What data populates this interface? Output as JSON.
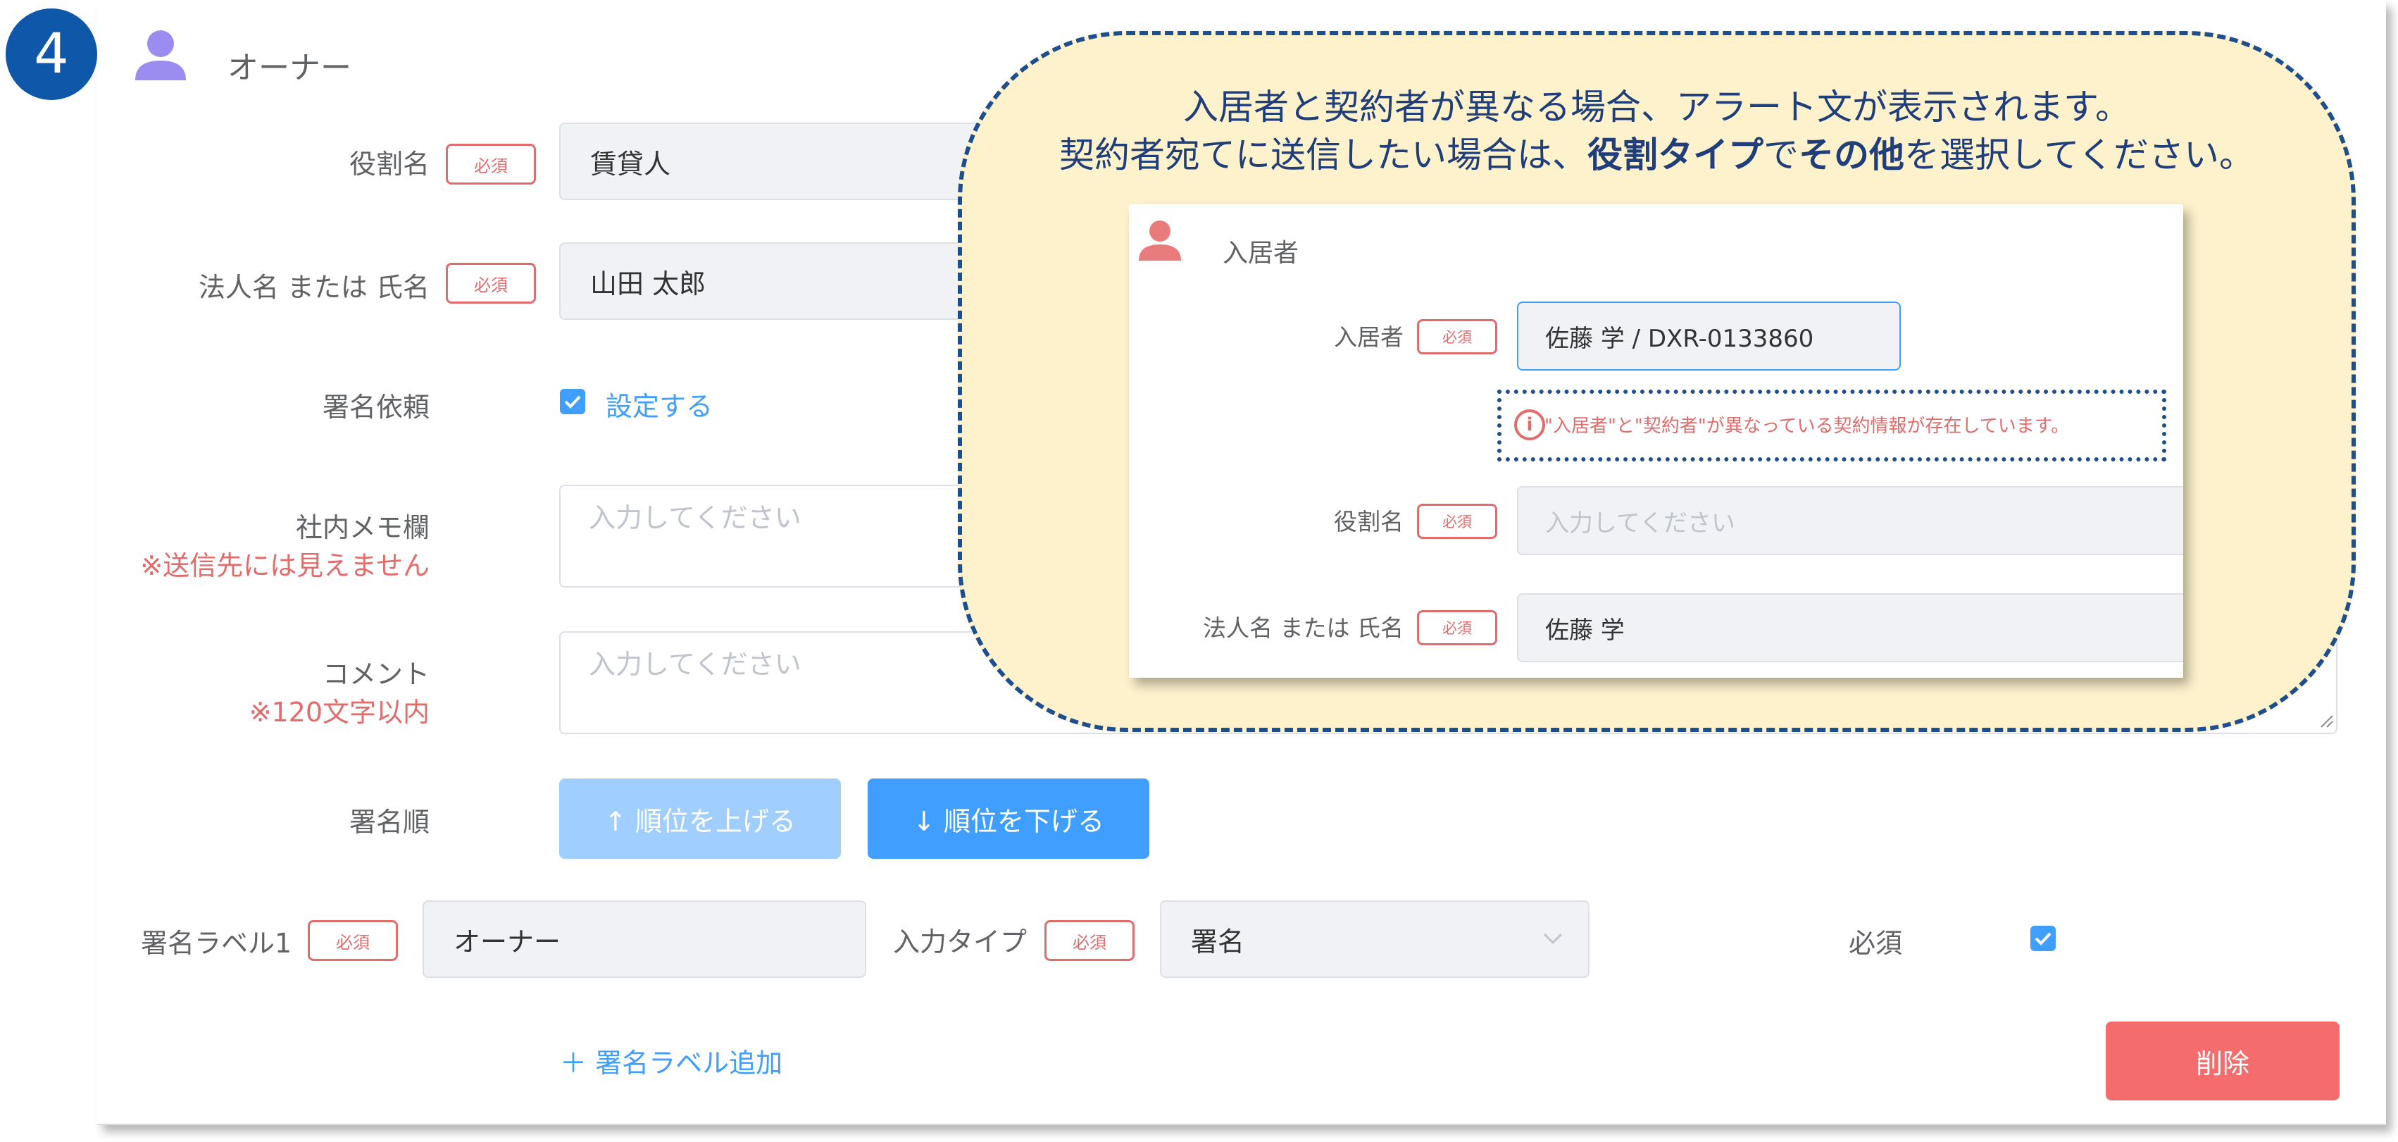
{
  "step": {
    "number": "4"
  },
  "owner": {
    "section_title": "オーナー",
    "required_badge": "必須",
    "role_name": {
      "label": "役割名",
      "value": "賃貸人"
    },
    "corp_name": {
      "label": "法人名 または 氏名",
      "value": "山田 太郎"
    },
    "sign_request": {
      "label": "署名依頼",
      "checkbox_label": "設定する",
      "checked": true
    },
    "internal_memo": {
      "label": "社内メモ欄",
      "note": "※送信先には見えません",
      "placeholder": "入力してください"
    },
    "comment": {
      "label": "コメント",
      "note": "※120文字以内",
      "placeholder": "入力してください"
    },
    "sign_order": {
      "label": "署名順",
      "up_button": "↑ 順位を上げる",
      "down_button": "↓ 順位を下げる"
    },
    "sign_label": {
      "label": "署名ラベル1",
      "value": "オーナー"
    },
    "input_type": {
      "label": "入力タイプ",
      "value": "署名"
    },
    "required_toggle": {
      "label": "必須",
      "checked": true
    },
    "add_label_link": "＋ 署名ラベル追加",
    "delete_button": "削除"
  },
  "callout": {
    "line1": "入居者と契約者が異なる場合、アラート文が表示されます。",
    "line2_prefix": "契約者宛てに送信したい場合は、",
    "line2_bold1": "役割タイプ",
    "line2_mid": "で",
    "line2_bold2": "その他",
    "line2_suffix": "を選択してください。"
  },
  "inset": {
    "section_title": "入居者",
    "required_badge": "必須",
    "tenant": {
      "label": "入居者",
      "value": "佐藤 学 / DXR-0133860"
    },
    "warning": "\"入居者\"と\"契約者\"が異なっている契約情報が存在しています。",
    "role_name": {
      "label": "役割名",
      "placeholder": "入力してください"
    },
    "corp_name": {
      "label": "法人名 または 氏名",
      "value": "佐藤 学"
    }
  },
  "colors": {
    "accent": "#409eff",
    "accent_light": "#a0cfff",
    "required": "#e06c6c",
    "delete": "#f56c6c",
    "callout_bg": "#fef2cc",
    "callout_border": "#1f4e8c",
    "step_circle": "#0f57a8",
    "owner_icon": "#9b8cf0",
    "tenant_icon": "#e87c7c"
  }
}
